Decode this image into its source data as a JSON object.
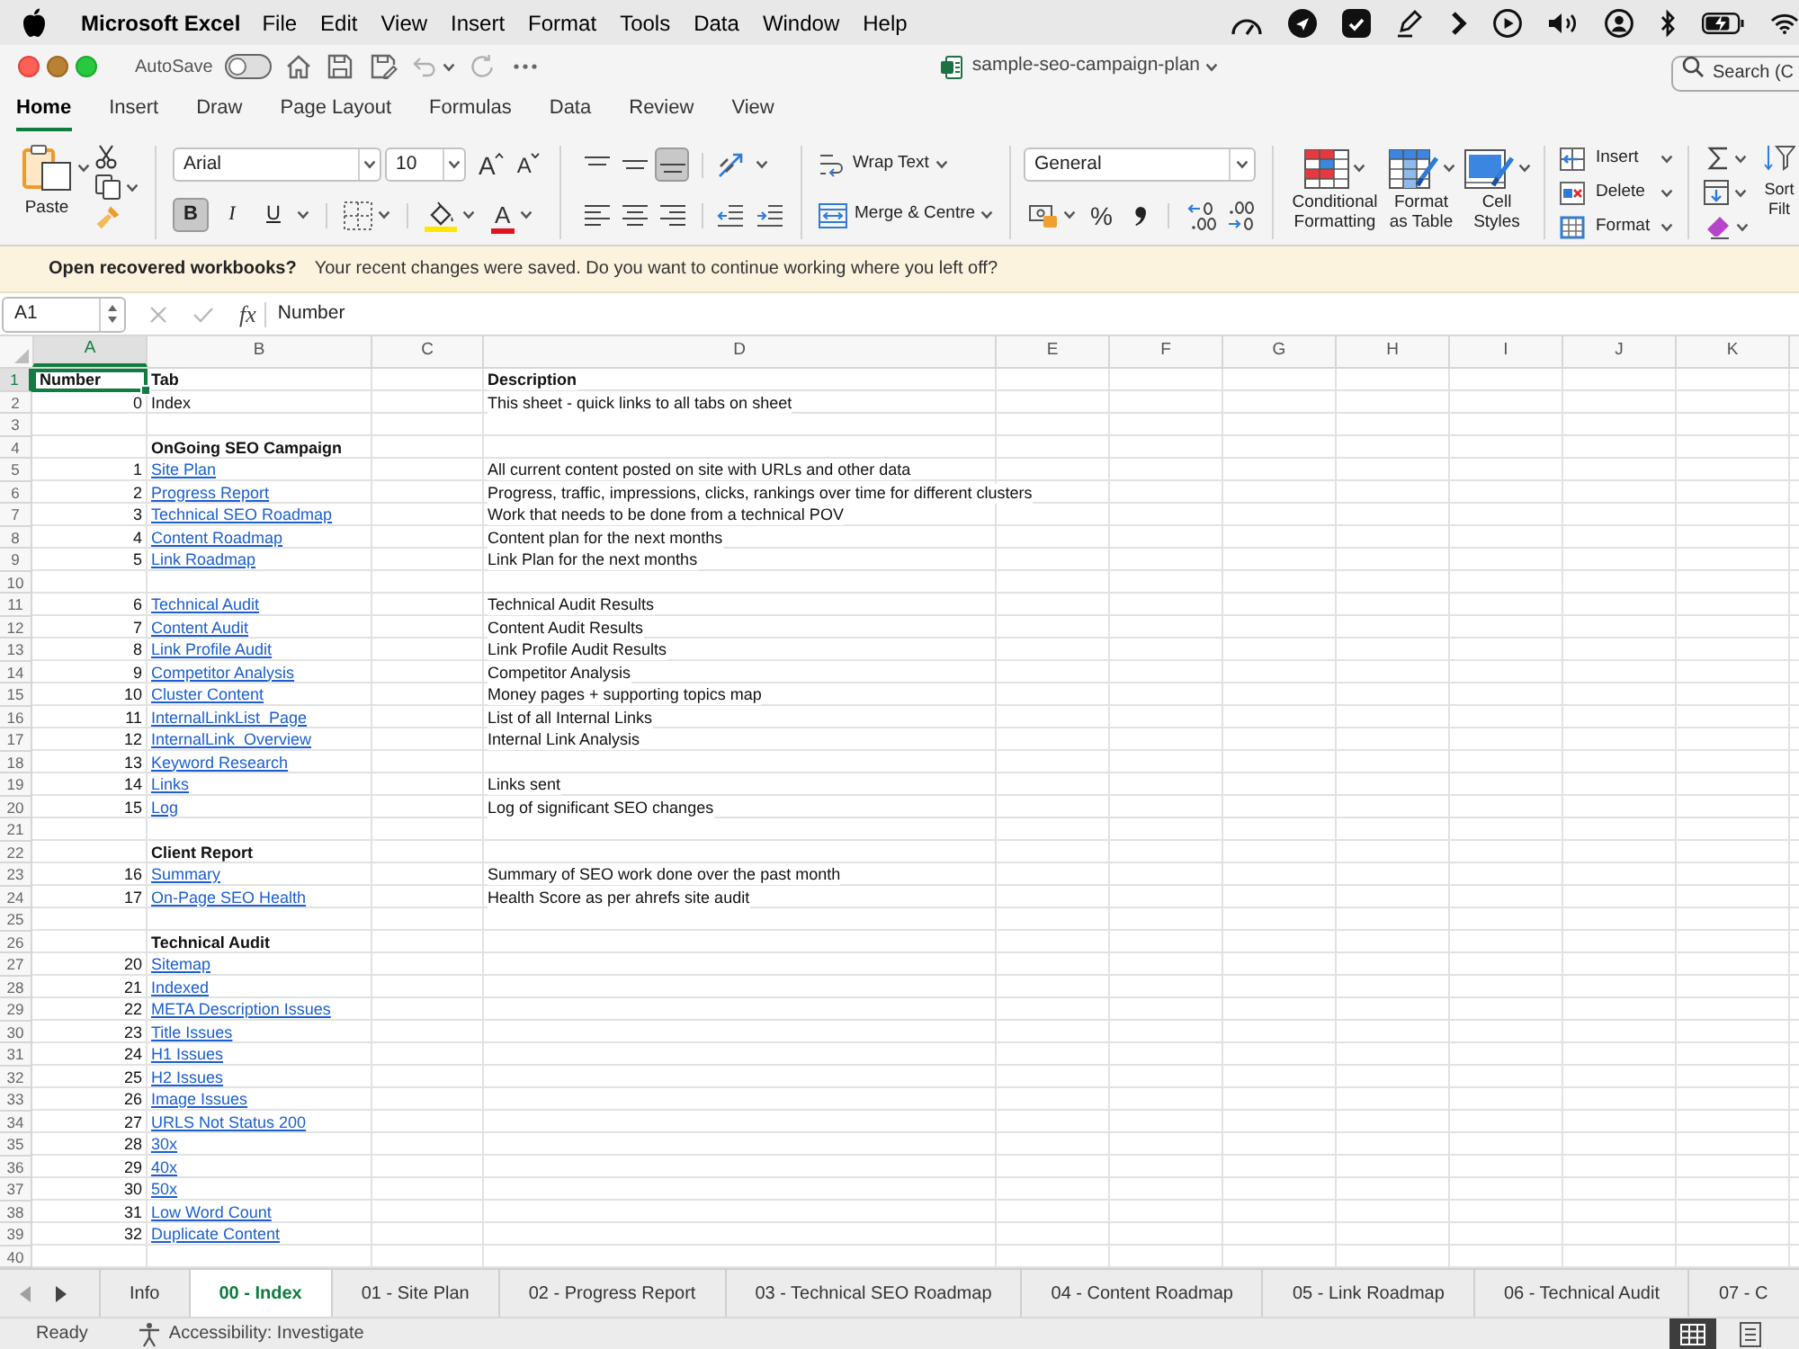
{
  "menu_bar": {
    "app_name": "Microsoft Excel",
    "items": [
      "File",
      "Edit",
      "View",
      "Insert",
      "Format",
      "Tools",
      "Data",
      "Window",
      "Help"
    ]
  },
  "title_bar": {
    "autosave": {
      "label": "AutoSave",
      "on": false
    },
    "title": "sample-seo-campaign-plan",
    "search": {
      "placeholder": "Search (C"
    }
  },
  "ribbon_tabs": [
    {
      "label": "Home",
      "selected": true
    },
    {
      "label": "Insert",
      "selected": false
    },
    {
      "label": "Draw",
      "selected": false
    },
    {
      "label": "Page Layout",
      "selected": false
    },
    {
      "label": "Formulas",
      "selected": false
    },
    {
      "label": "Data",
      "selected": false
    },
    {
      "label": "Review",
      "selected": false
    },
    {
      "label": "View",
      "selected": false
    }
  ],
  "ribbon": {
    "paste": {
      "label": "Paste"
    },
    "font": {
      "name": "Arial",
      "size": "10"
    },
    "font_size_buttons": [
      {
        "kind": "grow",
        "glyph": "A"
      },
      {
        "kind": "shrink",
        "glyph": "A"
      }
    ],
    "font_styles": [
      {
        "kind": "bold",
        "glyph": "B",
        "selected": true
      },
      {
        "kind": "italic",
        "glyph": "I",
        "selected": false
      },
      {
        "kind": "underline",
        "glyph": "U",
        "selected": false
      }
    ],
    "font_color": {
      "glyph": "A"
    },
    "vertical_align": [
      {
        "kind": "top",
        "selected": false
      },
      {
        "kind": "middle",
        "selected": false
      },
      {
        "kind": "bottom",
        "selected": true
      }
    ],
    "horizontal_align": [
      {
        "kind": "left",
        "selected": false
      },
      {
        "kind": "center",
        "selected": false
      },
      {
        "kind": "right",
        "selected": false
      }
    ],
    "wrap_text": {
      "label": "Wrap Text"
    },
    "merge": {
      "label": "Merge & Centre"
    },
    "number_format": {
      "value": "General"
    },
    "percent": {
      "glyph": "%"
    },
    "styles": [
      {
        "kind": "conditional",
        "label": "Conditional\nFormatting"
      },
      {
        "kind": "table",
        "label": "Format\nas Table"
      },
      {
        "kind": "cell_styles",
        "label": "Cell\nStyles"
      }
    ],
    "cells": [
      {
        "kind": "insert",
        "label": "Insert"
      },
      {
        "kind": "delete",
        "label": "Delete"
      },
      {
        "kind": "format",
        "label": "Format"
      }
    ],
    "sort_filter": {
      "label": "Sort\nFilt"
    }
  },
  "notification": {
    "title": "Open recovered workbooks?",
    "message": "Your recent changes were saved. Do you want to continue working where you left off?"
  },
  "formula_bar": {
    "name_box": "A1",
    "fx": "fx",
    "formula": "Number"
  },
  "sheet": {
    "columns": [
      {
        "label": "A",
        "selected": true
      },
      {
        "label": "B",
        "selected": false
      },
      {
        "label": "C",
        "selected": false
      },
      {
        "label": "D",
        "selected": false
      },
      {
        "label": "E",
        "selected": false
      },
      {
        "label": "F",
        "selected": false
      },
      {
        "label": "G",
        "selected": false
      },
      {
        "label": "H",
        "selected": false
      },
      {
        "label": "I",
        "selected": false
      },
      {
        "label": "J",
        "selected": false
      },
      {
        "label": "K",
        "selected": false
      }
    ],
    "rows": [
      {
        "label": "1",
        "selected": true,
        "kind": "header",
        "A": "Number",
        "B": "Tab",
        "D": "Description"
      },
      {
        "label": "2",
        "selected": false,
        "kind": "plain",
        "A": "0",
        "B": "Index",
        "D": "This sheet - quick links to all tabs on sheet"
      },
      {
        "label": "3",
        "selected": false,
        "kind": "empty"
      },
      {
        "label": "4",
        "selected": false,
        "kind": "section",
        "B": "OnGoing SEO Campaign"
      },
      {
        "label": "5",
        "selected": false,
        "kind": "link",
        "A": "1",
        "B": "Site Plan",
        "D": "All current content posted on site with URLs and other data"
      },
      {
        "label": "6",
        "selected": false,
        "kind": "link",
        "A": "2",
        "B": "Progress Report",
        "D": "Progress, traffic, impressions, clicks, rankings over time for different clusters"
      },
      {
        "label": "7",
        "selected": false,
        "kind": "link",
        "A": "3",
        "B": "Technical SEO Roadmap",
        "D": "Work that needs to be done from a technical POV"
      },
      {
        "label": "8",
        "selected": false,
        "kind": "link",
        "A": "4",
        "B": "Content Roadmap",
        "D": "Content plan for the next months"
      },
      {
        "label": "9",
        "selected": false,
        "kind": "link",
        "A": "5",
        "B": "Link Roadmap",
        "D": "Link Plan for the next months"
      },
      {
        "label": "10",
        "selected": false,
        "kind": "empty"
      },
      {
        "label": "11",
        "selected": false,
        "kind": "link",
        "A": "6",
        "B": "Technical Audit",
        "D": "Technical Audit Results"
      },
      {
        "label": "12",
        "selected": false,
        "kind": "link",
        "A": "7",
        "B": "Content Audit",
        "D": "Content Audit Results"
      },
      {
        "label": "13",
        "selected": false,
        "kind": "link",
        "A": "8",
        "B": "Link Profile Audit",
        "D": "Link Profile Audit Results"
      },
      {
        "label": "14",
        "selected": false,
        "kind": "link",
        "A": "9",
        "B": "Competitor Analysis",
        "D": "Competitor Analysis"
      },
      {
        "label": "15",
        "selected": false,
        "kind": "link",
        "A": "10",
        "B": "Cluster Content",
        "D": "Money pages + supporting topics map"
      },
      {
        "label": "16",
        "selected": false,
        "kind": "link",
        "A": "11",
        "B": "InternalLinkList_Page",
        "D": "List of all Internal Links"
      },
      {
        "label": "17",
        "selected": false,
        "kind": "link",
        "A": "12",
        "B": "InternalLink_Overview",
        "D": "Internal Link Analysis"
      },
      {
        "label": "18",
        "selected": false,
        "kind": "link",
        "A": "13",
        "B": "Keyword Research"
      },
      {
        "label": "19",
        "selected": false,
        "kind": "link",
        "A": "14",
        "B": "Links",
        "D": "Links sent"
      },
      {
        "label": "20",
        "selected": false,
        "kind": "link",
        "A": "15",
        "B": "Log",
        "D": "Log of significant SEO changes"
      },
      {
        "label": "21",
        "selected": false,
        "kind": "empty"
      },
      {
        "label": "22",
        "selected": false,
        "kind": "section",
        "B": "Client Report"
      },
      {
        "label": "23",
        "selected": false,
        "kind": "link",
        "A": "16",
        "B": "Summary",
        "D": "Summary of SEO work done over the past month"
      },
      {
        "label": "24",
        "selected": false,
        "kind": "link",
        "A": "17",
        "B": "On-Page SEO Health",
        "D": "Health Score as per ahrefs site audit"
      },
      {
        "label": "25",
        "selected": false,
        "kind": "empty"
      },
      {
        "label": "26",
        "selected": false,
        "kind": "section",
        "B": "Technical Audit"
      },
      {
        "label": "27",
        "selected": false,
        "kind": "link",
        "A": "20",
        "B": "Sitemap"
      },
      {
        "label": "28",
        "selected": false,
        "kind": "link",
        "A": "21",
        "B": "Indexed"
      },
      {
        "label": "29",
        "selected": false,
        "kind": "link",
        "A": "22",
        "B": "META Description Issues"
      },
      {
        "label": "30",
        "selected": false,
        "kind": "link",
        "A": "23",
        "B": "Title Issues"
      },
      {
        "label": "31",
        "selected": false,
        "kind": "link",
        "A": "24",
        "B": "H1 Issues"
      },
      {
        "label": "32",
        "selected": false,
        "kind": "link",
        "A": "25",
        "B": "H2 Issues"
      },
      {
        "label": "33",
        "selected": false,
        "kind": "link",
        "A": "26",
        "B": "Image Issues"
      },
      {
        "label": "34",
        "selected": false,
        "kind": "link",
        "A": "27",
        "B": "URLS Not Status 200"
      },
      {
        "label": "35",
        "selected": false,
        "kind": "link",
        "A": "28",
        "B": "30x"
      },
      {
        "label": "36",
        "selected": false,
        "kind": "link",
        "A": "29",
        "B": "40x"
      },
      {
        "label": "37",
        "selected": false,
        "kind": "link",
        "A": "30",
        "B": "50x"
      },
      {
        "label": "38",
        "selected": false,
        "kind": "link",
        "A": "31",
        "B": "Low Word Count"
      },
      {
        "label": "39",
        "selected": false,
        "kind": "link",
        "A": "32",
        "B": "Duplicate Content"
      },
      {
        "label": "40",
        "selected": false,
        "kind": "empty"
      }
    ]
  },
  "sheet_tabs": [
    {
      "label": "Info",
      "selected": false
    },
    {
      "label": "00 - Index",
      "selected": true
    },
    {
      "label": "01 - Site Plan",
      "selected": false
    },
    {
      "label": "02 - Progress Report",
      "selected": false
    },
    {
      "label": "03 - Technical SEO Roadmap",
      "selected": false
    },
    {
      "label": "04 - Content Roadmap",
      "selected": false
    },
    {
      "label": "05 - Link Roadmap",
      "selected": false
    },
    {
      "label": "06 - Technical Audit",
      "selected": false
    },
    {
      "label": "07 - C",
      "selected": false
    }
  ],
  "status_bar": {
    "status": "Ready",
    "accessibility": "Accessibility: Investigate",
    "views": [
      {
        "kind": "normal",
        "selected": true
      },
      {
        "kind": "page_layout",
        "selected": false
      }
    ]
  }
}
